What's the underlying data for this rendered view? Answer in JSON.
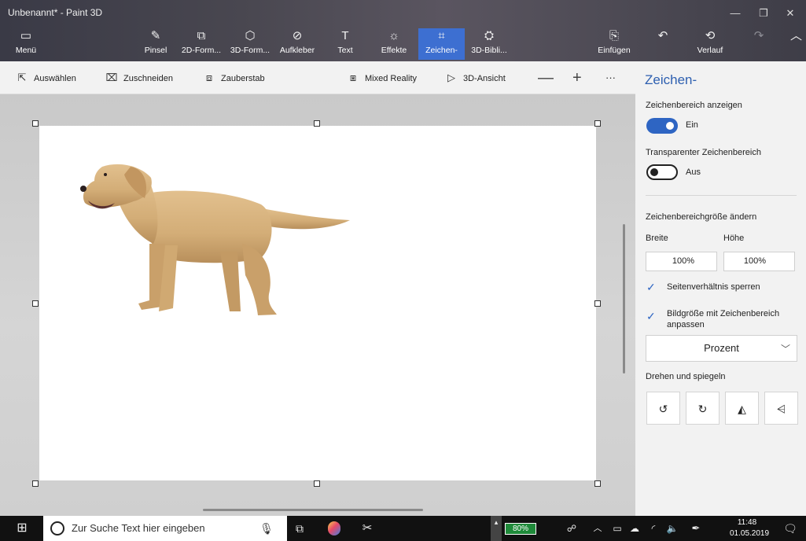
{
  "window": {
    "title": "Unbenannt* - Paint 3D",
    "controls": {
      "minimize": "—",
      "restore": "❐",
      "close": "✕"
    }
  },
  "ribbon": {
    "menu": "Menü",
    "tools": [
      {
        "label": "Pinsel",
        "icon": "brush-icon"
      },
      {
        "label": "2D-Form...",
        "icon": "2d-shapes-icon"
      },
      {
        "label": "3D-Form...",
        "icon": "3d-shapes-icon"
      },
      {
        "label": "Aufkleber",
        "icon": "stickers-icon"
      },
      {
        "label": "Text",
        "icon": "text-icon"
      },
      {
        "label": "Effekte",
        "icon": "effects-icon"
      },
      {
        "label": "Zeichen-",
        "icon": "canvas-icon",
        "active": true
      },
      {
        "label": "3D-Bibli...",
        "icon": "3d-library-icon"
      }
    ],
    "paste": "Einfügen",
    "history": "Verlauf",
    "accent": "#3d6fd1"
  },
  "toolbar": {
    "select": "Auswählen",
    "crop": "Zuschneiden",
    "magic_select": "Zauberstab",
    "mixed_reality": "Mixed Reality",
    "view_3d": "3D-Ansicht",
    "zoom_out": "—",
    "zoom_in": "+",
    "more": "···"
  },
  "panel": {
    "title": "Zeichen-",
    "show_canvas_label": "Zeichenbereich anzeigen",
    "show_canvas_state": "Ein",
    "transparent_label": "Transparenter Zeichenbereich",
    "transparent_state": "Aus",
    "resize_label": "Zeichenbereichgröße ändern",
    "width_label": "Breite",
    "height_label": "Höhe",
    "width_value": "100%",
    "height_value": "100%",
    "lock_aspect_label": "Seitenverhältnis sperren",
    "resize_image_label": "Bildgröße mit Zeichenbereich anpassen",
    "unit_value": "Prozent",
    "rotate_label": "Drehen und spiegeln"
  },
  "taskbar": {
    "search_placeholder": "Zur Suche Text hier eingeben",
    "battery": "80%",
    "time": "11:48",
    "date": "01.05.2019"
  }
}
